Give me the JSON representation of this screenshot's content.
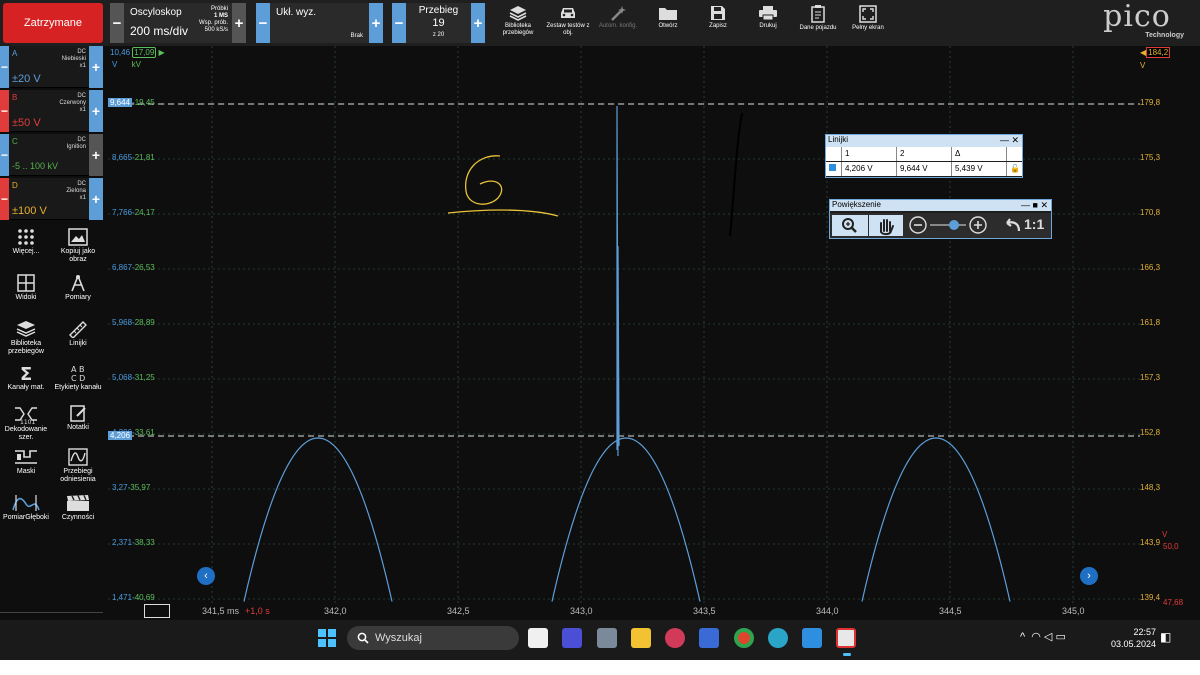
{
  "toolbar": {
    "stop_label": "Zatrzymane",
    "scope": {
      "title": "Oscyloskop",
      "value": "200 ms/div",
      "samples_label": "Próbki",
      "samples_value": "1 MS",
      "rate_label": "Wsp. prób.",
      "rate_value": "500 kS/s"
    },
    "trigger": {
      "title": "Ukł. wyz.",
      "mode": "Brak"
    },
    "capture": {
      "title": "Przebieg",
      "value": "19",
      "of": "z 20"
    },
    "buttons": [
      {
        "label": "Biblioteka przebiegów",
        "icon": "library-icon"
      },
      {
        "label": "Zestaw testów z obj.",
        "icon": "car-icon"
      },
      {
        "label": "Autom. konfig.",
        "icon": "wand-icon"
      },
      {
        "label": "Otwórz",
        "icon": "folder-icon"
      },
      {
        "label": "Zapisz",
        "icon": "save-icon"
      },
      {
        "label": "Drukuj",
        "icon": "printer-icon"
      },
      {
        "label": "Dane pojazdu",
        "icon": "clipboard-icon"
      },
      {
        "label": "Pełny ekran",
        "icon": "fullscreen-icon"
      }
    ],
    "logo": "pico",
    "logo_sub": "Technology"
  },
  "channels": [
    {
      "letter": "A",
      "coupling": "DC",
      "probe": "Niebieski",
      "mult": "x1",
      "range": "±20 V",
      "color": "#5d9ed9"
    },
    {
      "letter": "B",
      "coupling": "DC",
      "probe": "Czerwony",
      "mult": "x1",
      "range": "±50 V",
      "color": "#e03c3c"
    },
    {
      "letter": "C",
      "coupling": "DC",
      "probe": "Ignition",
      "mult": "",
      "range": "-5 .. 100 kV",
      "color": "#55b04e"
    },
    {
      "letter": "D",
      "coupling": "DC",
      "probe": "Zielona",
      "mult": "x1",
      "range": "±100 V",
      "color": "#e8b02c"
    }
  ],
  "tools": [
    {
      "label": "Więcej...",
      "icon": "grid-dots-icon"
    },
    {
      "label": "Kopiuj jako obraz",
      "icon": "image-icon"
    },
    {
      "label": "Widoki",
      "icon": "views-icon"
    },
    {
      "label": "Pomiary",
      "icon": "compass-icon"
    },
    {
      "label": "Biblioteka przebiegów",
      "icon": "library-icon"
    },
    {
      "label": "Linijki",
      "icon": "ruler-icon"
    },
    {
      "label": "Kanały mat.",
      "icon": "sigma-icon"
    },
    {
      "label": "Etykiety kanału",
      "icon": "abcd-icon"
    },
    {
      "label": "Dekodowanie szer.",
      "icon": "decode-icon"
    },
    {
      "label": "Notatki",
      "icon": "notes-icon"
    },
    {
      "label": "Maski",
      "icon": "mask-icon"
    },
    {
      "label": "Przebiegi odniesienia",
      "icon": "reference-icon"
    },
    {
      "label": "PomiarGłęboki",
      "icon": "deep-measure-icon"
    },
    {
      "label": "Czynności",
      "icon": "clapper-icon"
    }
  ],
  "plot": {
    "top_left_unit_a": "10,46",
    "top_left_unit_c": "17,09",
    "unit_a": "V",
    "unit_c": "kV",
    "left_ticks": [
      {
        "a": "9,644",
        "c": "19,45"
      },
      {
        "a": "8,665",
        "c": "21,81"
      },
      {
        "a": "7,766",
        "c": "24,17"
      },
      {
        "a": "6,867",
        "c": "26,53"
      },
      {
        "a": "5,968",
        "c": "28,89"
      },
      {
        "a": "5,068",
        "c": "31,25"
      },
      {
        "a": "4,206",
        "c": "33,61"
      },
      {
        "a": "3,27",
        "c": "35,97"
      },
      {
        "a": "2,371",
        "c": "38,33"
      },
      {
        "a": "1,471",
        "c": "40,69"
      }
    ],
    "right_top": "184,2",
    "right_unit": "V",
    "right_ticks": [
      "179,8",
      "175,3",
      "170,8",
      "166,3",
      "161,8",
      "157,3",
      "152,8",
      "148,3",
      "143,9",
      "139,4"
    ],
    "b_unit": "V",
    "b_ticks": [
      "50,0",
      "47,68"
    ],
    "x_start": "341,5 ms",
    "x_offset": "+1,0 s",
    "x_ticks": [
      "342,0",
      "342,5",
      "343,0",
      "343,5",
      "344,0",
      "344,5",
      "345,0"
    ],
    "ruler_high": "9,644",
    "ruler_low": "4,206"
  },
  "rulers_window": {
    "title": "Linijki",
    "headers": [
      "",
      "1",
      "2",
      "Δ"
    ],
    "row": [
      "4,206 V",
      "9,644 V",
      "5,439 V"
    ]
  },
  "zoom_window": {
    "title": "Powiększenie",
    "ratio": "1:1"
  },
  "taskbar": {
    "search_placeholder": "Wyszukaj",
    "time": "22:57",
    "date": "03.05.2024"
  }
}
